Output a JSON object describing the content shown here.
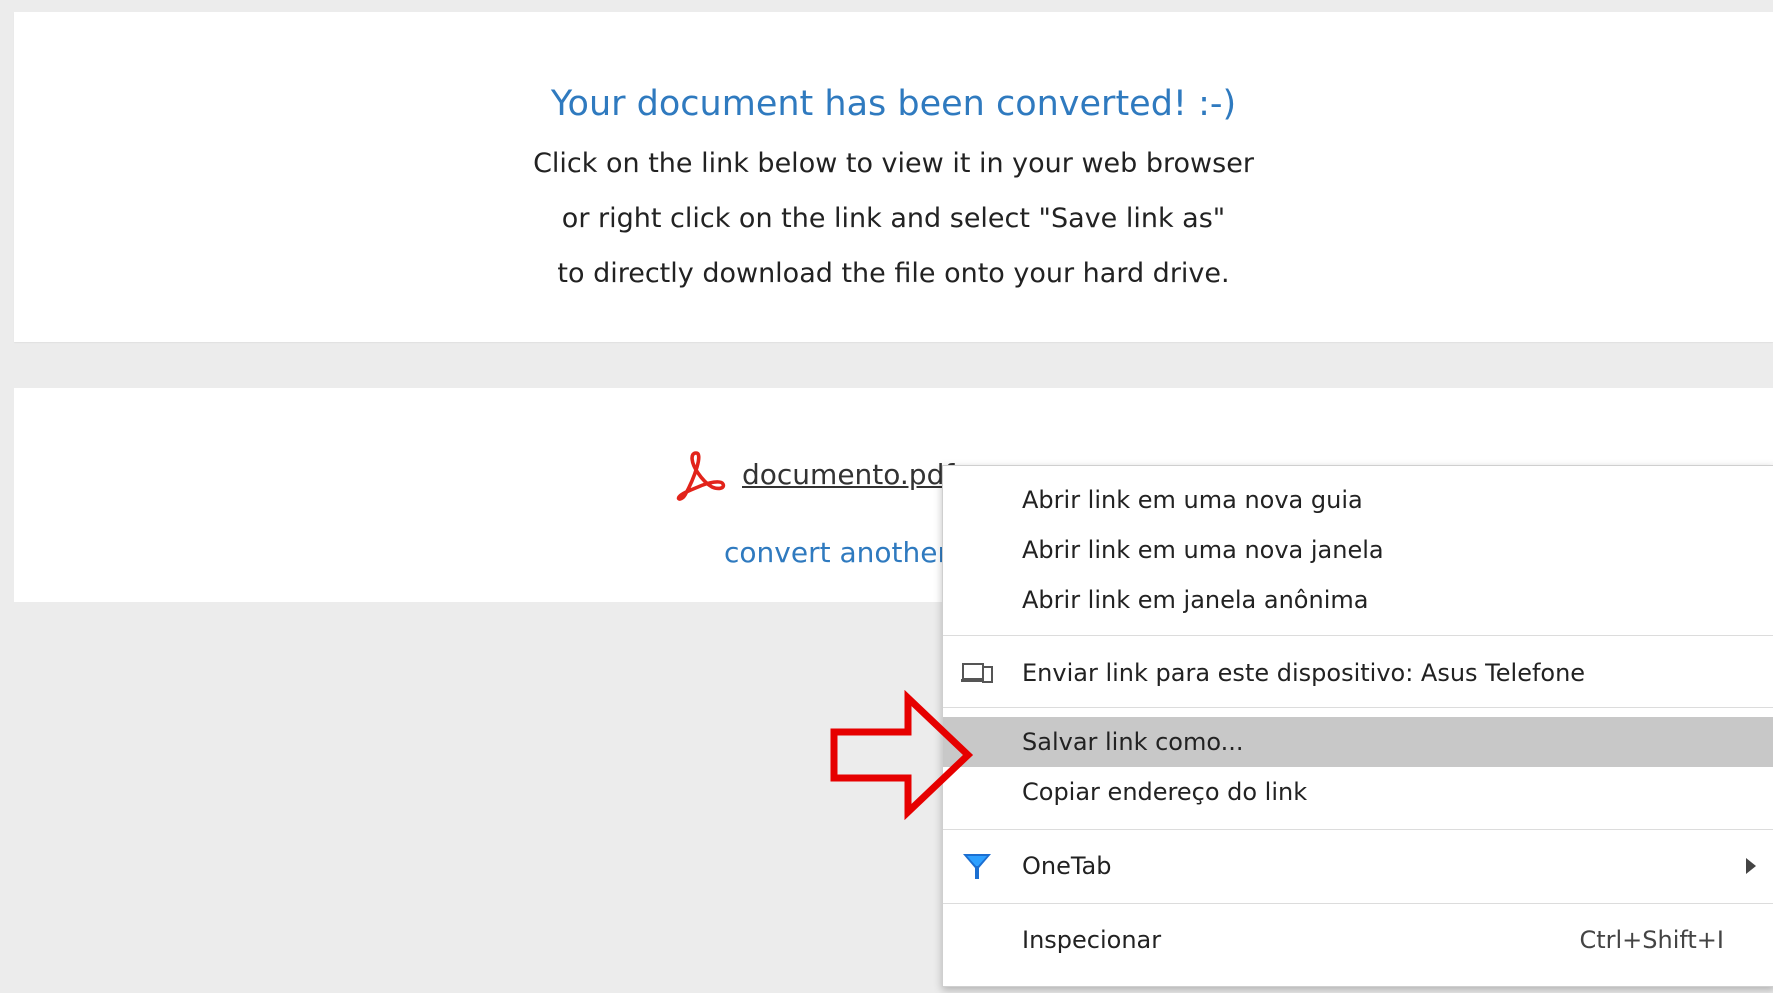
{
  "converted": {
    "heading": "Your document has been converted! :-)",
    "line1": "Click on the link below to view it in your web browser",
    "line2": "or right click on the link and select \"Save link as\"",
    "line3": "to directly download the file onto your hard drive."
  },
  "download": {
    "file_icon": "pdf-icon",
    "file_name": "documento.pdf",
    "convert_another": "convert another"
  },
  "context_menu": {
    "open_new_tab": "Abrir link em uma nova guia",
    "open_new_window": "Abrir link em uma nova janela",
    "open_incognito": "Abrir link em janela anônima",
    "send_to_device": "Enviar link para este dispositivo: Asus Telefone",
    "save_link_as": "Salvar link como...",
    "copy_link_address": "Copiar endereço do link",
    "onetab": "OneTab",
    "inspect": "Inspecionar",
    "inspect_shortcut": "Ctrl+Shift+I"
  },
  "colors": {
    "link_blue": "#2f7abf",
    "pdf_red": "#e2231a",
    "highlight": "#c8c8c8",
    "annotation_arrow": "#e60000"
  }
}
